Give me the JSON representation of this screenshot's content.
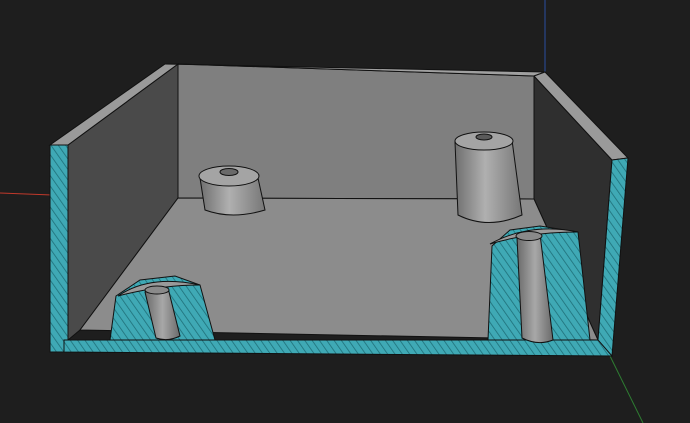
{
  "viewport": {
    "background": "#1e1e1e"
  },
  "axes": {
    "x_color": "#c0392b",
    "y_color": "#2e7d32",
    "z_color": "#2a4ea0"
  },
  "model": {
    "wall_color": "#8a8a8a",
    "floor_color": "#8c8c8c",
    "inner_wall_left_color": "#4a4a4a",
    "inner_wall_right_color": "#333333",
    "section_fill_color": "#3fa9b5",
    "section_hatch_color": "#1f6f78",
    "boss_color": "#9a9a9a",
    "edge_color": "#111111"
  }
}
